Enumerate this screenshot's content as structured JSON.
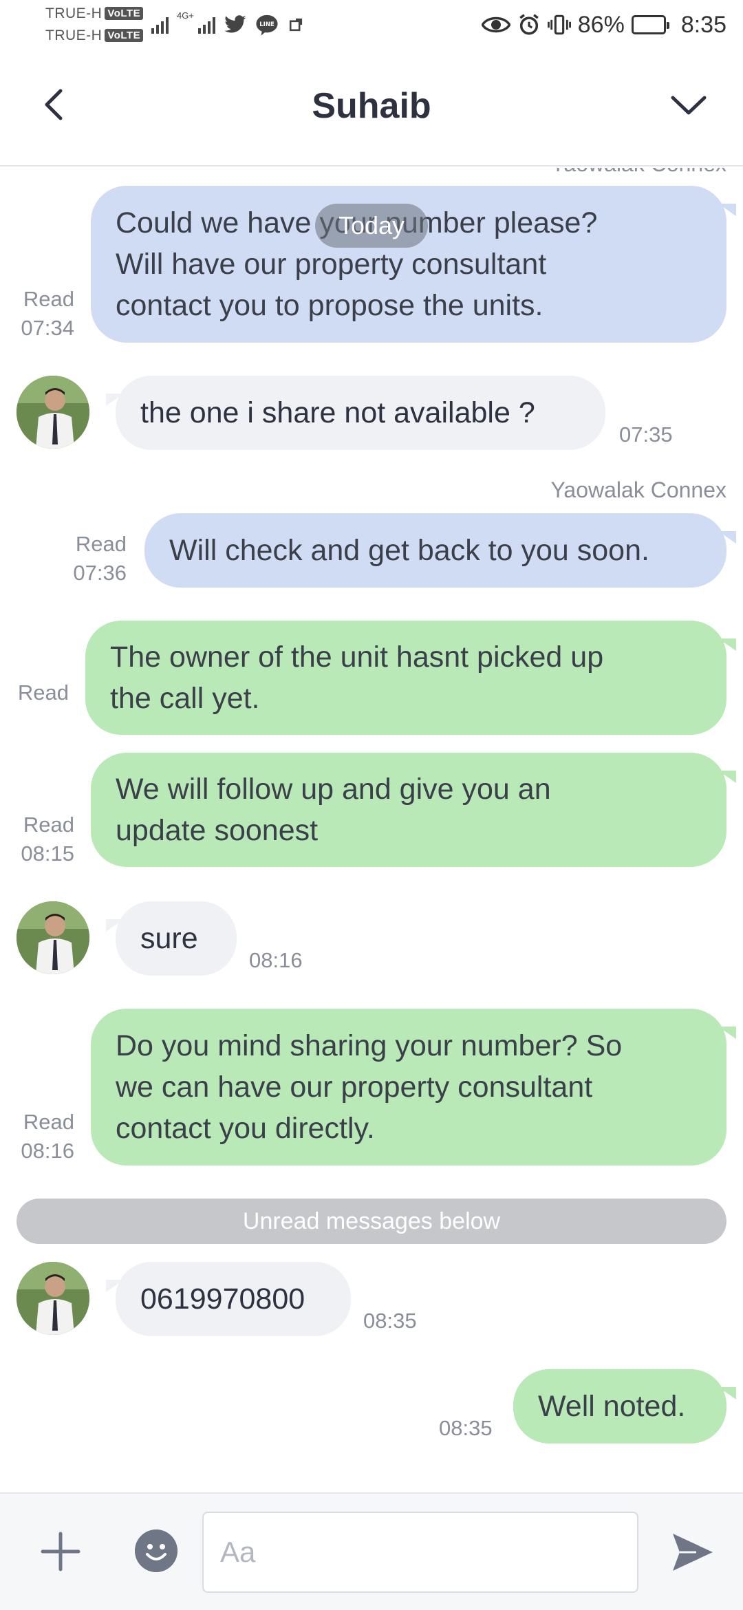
{
  "status_bar": {
    "carrier_1": "TRUE-H",
    "carrier_2": "TRUE-H",
    "volte_label": "VoLTE",
    "network_type": "4G+",
    "battery": "86%",
    "battery_level": 0.86,
    "time": "8:35",
    "icons": [
      "signal-icon",
      "twitter-icon",
      "line-app-icon",
      "eye-icon",
      "alarm-icon",
      "vibrate-icon",
      "battery-icon"
    ]
  },
  "header": {
    "title": "Suhaib",
    "back_icon": "chevron-left-icon",
    "menu_icon": "chevron-down-icon"
  },
  "chat": {
    "today_label": "Today",
    "unread_label": "Unread messages below",
    "messages": [
      {
        "sender": "Yaowalak Connex",
        "text": "Could we have your number please?\nWill have our property consultant\ncontact you to propose the units.",
        "read": "Read",
        "time": "07:34"
      },
      {
        "sender": "Suhaib",
        "text": "the one i share not available ?",
        "time": "07:35"
      },
      {
        "sender": "Yaowalak Connex",
        "text": "Will check and get back to you soon.",
        "read": "Read",
        "time": "07:36"
      },
      {
        "sender": "",
        "text": "The owner of the unit hasnt picked up\nthe call yet.",
        "read": "Read",
        "time": ""
      },
      {
        "sender": "",
        "text": "We will follow up and give you an\nupdate soonest",
        "read": "Read",
        "time": "08:15"
      },
      {
        "sender": "Suhaib",
        "text": "sure",
        "time": "08:16"
      },
      {
        "sender": "",
        "text": "Do you mind sharing your number? So\nwe can have our property consultant\ncontact you directly.",
        "read": "Read",
        "time": "08:16"
      },
      {
        "sender": "Suhaib",
        "text": "0619970800",
        "time": "08:35"
      },
      {
        "sender": "",
        "text": "Well noted.",
        "read": "",
        "time": "08:35"
      }
    ]
  },
  "input": {
    "placeholder": "Aa",
    "value": ""
  },
  "colors": {
    "bubble_blue": "#cfdcf3",
    "bubble_green": "#b8e9b6",
    "bubble_gray": "#eff1f4",
    "text": "#2d3140",
    "muted": "#8a8e99"
  }
}
